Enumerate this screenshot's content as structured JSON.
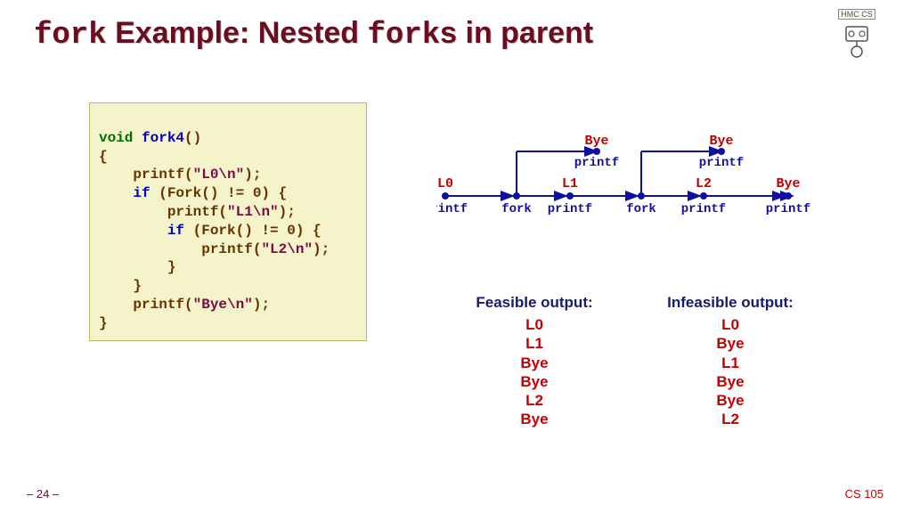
{
  "title": {
    "part1": "fork",
    "part2": " Example: Nested ",
    "part3": "fork",
    "part4": "s in parent"
  },
  "logo_label": "HMC CS",
  "code": {
    "l01_kw": "void",
    "l01_fn": " fork4",
    "l01_rest": "()",
    "l02": "{",
    "l03_a": "    printf(",
    "l03_str": "\"L0\\n\"",
    "l03_b": ");",
    "l04_a": "    ",
    "l04_kw": "if",
    "l04_b": " (Fork() != 0) {",
    "l05_a": "        printf(",
    "l05_str": "\"L1\\n\"",
    "l05_b": ");",
    "l06_a": "        ",
    "l06_kw": "if",
    "l06_b": " (Fork() != 0) {",
    "l07_a": "            printf(",
    "l07_str": "\"L2\\n\"",
    "l07_b": ");",
    "l08": "        }",
    "l09": "    }",
    "l10_a": "    printf(",
    "l10_str": "\"Bye\\n\"",
    "l10_b": ");",
    "l11": "}"
  },
  "diagram": {
    "main_labels": [
      "L0",
      "L1",
      "L2",
      "Bye"
    ],
    "main_sublabs": [
      "printf",
      "fork",
      "printf",
      "fork",
      "printf",
      "printf"
    ],
    "branch_label": "Bye",
    "branch_sub": "printf"
  },
  "outputs": {
    "feasible_hdr": "Feasible output:",
    "feasible": [
      "L0",
      "L1",
      "Bye",
      "Bye",
      "L2",
      "Bye"
    ],
    "infeasible_hdr": "Infeasible output:",
    "infeasible": [
      "L0",
      "Bye",
      "L1",
      "Bye",
      "Bye",
      "L2"
    ]
  },
  "footer": {
    "left": "– 24 –",
    "right": "CS 105"
  }
}
